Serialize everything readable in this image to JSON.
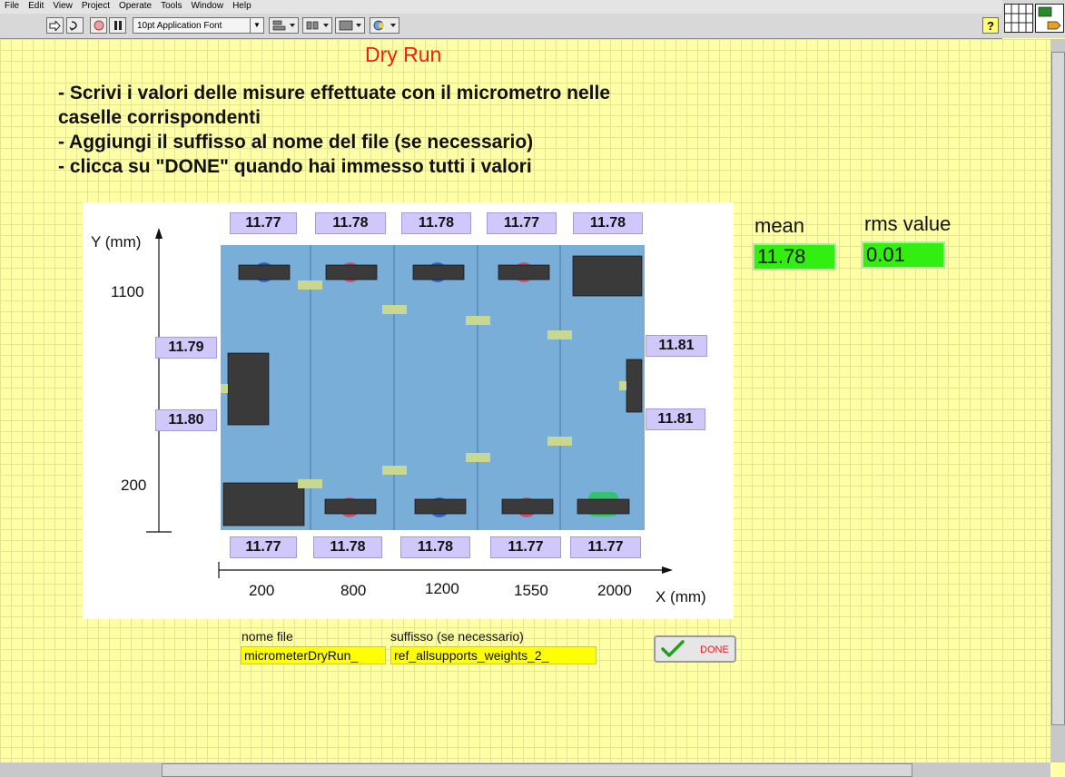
{
  "menu": [
    "File",
    "Edit",
    "View",
    "Project",
    "Operate",
    "Tools",
    "Window",
    "Help"
  ],
  "toolbar": {
    "font": "10pt Application Font",
    "help": "?"
  },
  "title": "Dry Run",
  "instructions": [
    "- Scrivi i valori delle misure effettuate con il micrometro nelle",
    "caselle corrispondenti",
    "- Aggiungi il suffisso al nome del file (se necessario)",
    "- clicca su \"DONE\" quando hai immesso tutti i valori"
  ],
  "diagram": {
    "y_axis_label": "Y (mm)",
    "x_axis_label": "X (mm)",
    "y_ticks": [
      "1100",
      "200"
    ],
    "x_ticks": [
      "200",
      "800",
      "1200",
      "1550",
      "2000"
    ],
    "top_values": [
      "11.77",
      "11.78",
      "11.78",
      "11.77",
      "11.78"
    ],
    "bottom_values": [
      "11.77",
      "11.78",
      "11.78",
      "11.77",
      "11.77"
    ],
    "left_values": [
      "11.79",
      "11.80"
    ],
    "right_values": [
      "11.81",
      "11.81"
    ]
  },
  "stats": {
    "mean_label": "mean",
    "mean_value": "11.78",
    "rms_label": "rms value",
    "rms_value": "0.01"
  },
  "fields": {
    "file_name_label": "nome file",
    "file_name_value": "micrometerDryRun_",
    "suffix_label": "suffisso (se necessario)",
    "suffix_value": "ref_allsupports_weights_2_"
  },
  "done_label": "DONE",
  "colors": {
    "accent_title": "#f02010",
    "indicator": "#33ee11",
    "field": "#ffff00",
    "measure_box": "#d0c8fa"
  }
}
